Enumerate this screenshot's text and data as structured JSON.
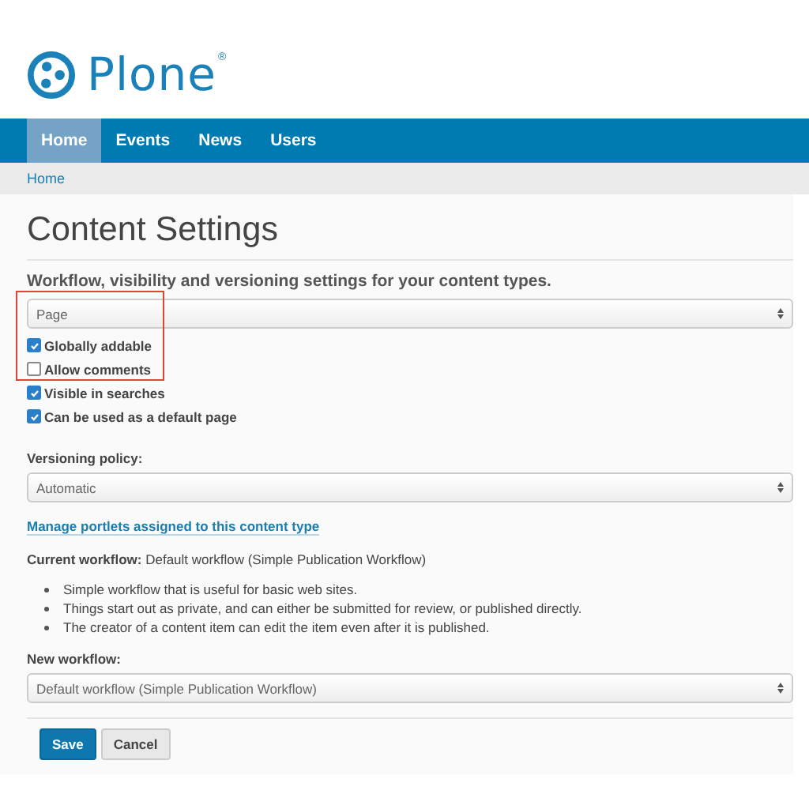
{
  "logo": {
    "text": "Plone",
    "mark": "®"
  },
  "nav": [
    {
      "label": "Home",
      "selected": true
    },
    {
      "label": "Events",
      "selected": false
    },
    {
      "label": "News",
      "selected": false
    },
    {
      "label": "Users",
      "selected": false
    }
  ],
  "breadcrumbs": [
    "Home"
  ],
  "title": "Content Settings",
  "description": "Workflow, visibility and versioning settings for your content types.",
  "content_type": {
    "value": "Page"
  },
  "options": [
    {
      "label": "Globally addable",
      "checked": true
    },
    {
      "label": "Allow comments",
      "checked": false
    },
    {
      "label": "Visible in searches",
      "checked": true
    },
    {
      "label": "Can be used as a default page",
      "checked": true
    }
  ],
  "versioning": {
    "label": "Versioning policy:",
    "value": "Automatic"
  },
  "portlets_link": "Manage portlets assigned to this content type",
  "current_workflow": "**Current workflow:** Default workflow (Simple Publication Workflow)",
  "workflow_notes": [
    "Simple workflow that is useful for basic web sites.",
    "Things start out as private, and can either be submitted for review, or published directly.",
    "The creator of a content item can edit the item even after it is published."
  ],
  "new_workflow": {
    "label": "New workflow:",
    "value": "Default workflow (Simple Publication Workflow)"
  },
  "buttons": [
    {
      "label": "Save",
      "kind": "primary"
    },
    {
      "label": "Cancel",
      "kind": "secondary"
    }
  ]
}
